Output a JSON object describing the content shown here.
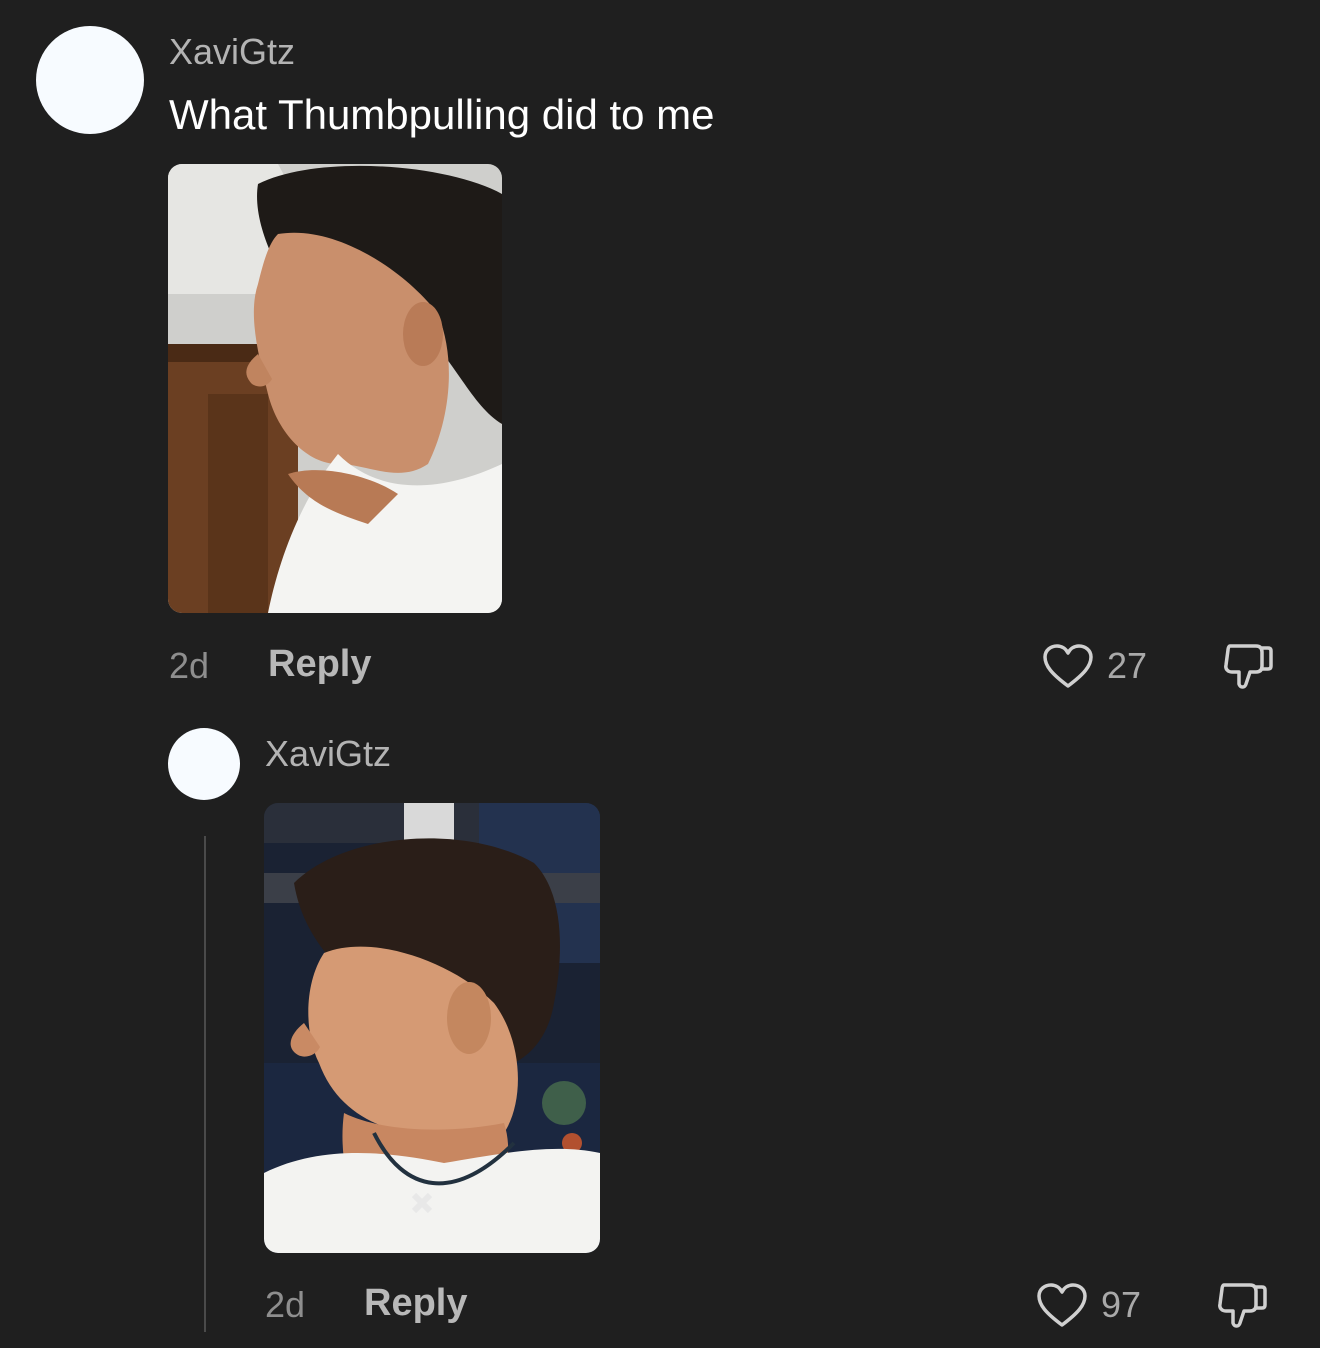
{
  "comment": {
    "username": "XaviGtz",
    "text": "What Thumbpulling did to me",
    "time": "2d",
    "reply_label": "Reply",
    "likes": "27",
    "photo_alt": "profile photo"
  },
  "reply": {
    "username": "XaviGtz",
    "time": "2d",
    "reply_label": "Reply",
    "likes": "97",
    "photo_alt": "profile photo"
  },
  "icons": {
    "like": "heart-outline-icon",
    "dislike": "thumbs-down-icon"
  },
  "colors": {
    "background": "#1f1f1f",
    "avatar": "#f7fbff",
    "muted_text": "#b3b3b3",
    "primary_text": "#ffffff"
  }
}
